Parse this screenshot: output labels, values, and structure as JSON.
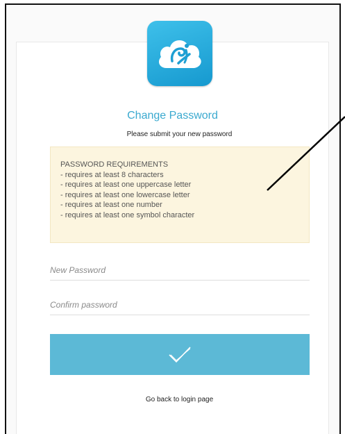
{
  "form": {
    "title": "Change Password",
    "subtitle": "Please submit your new password",
    "requirements": {
      "heading": "PASSWORD REQUIREMENTS",
      "items": [
        "- requires at least 8 characters",
        "- requires at least one uppercase letter",
        "- requires at least one lowercase letter",
        "- requires at least one number",
        "- requires at least one symbol character"
      ]
    },
    "new_password": {
      "placeholder": "New Password",
      "value": ""
    },
    "confirm_password": {
      "placeholder": "Confirm password",
      "value": ""
    },
    "submit_icon": "checkmark-icon",
    "back_link": "Go back to login page"
  },
  "logo": {
    "icon": "cloud-logo-icon"
  },
  "colors": {
    "accent": "#3aa9cf",
    "button": "#5cb9d6",
    "requirements_bg": "#fcf5df",
    "logo_bg": "#1ea6d8"
  }
}
